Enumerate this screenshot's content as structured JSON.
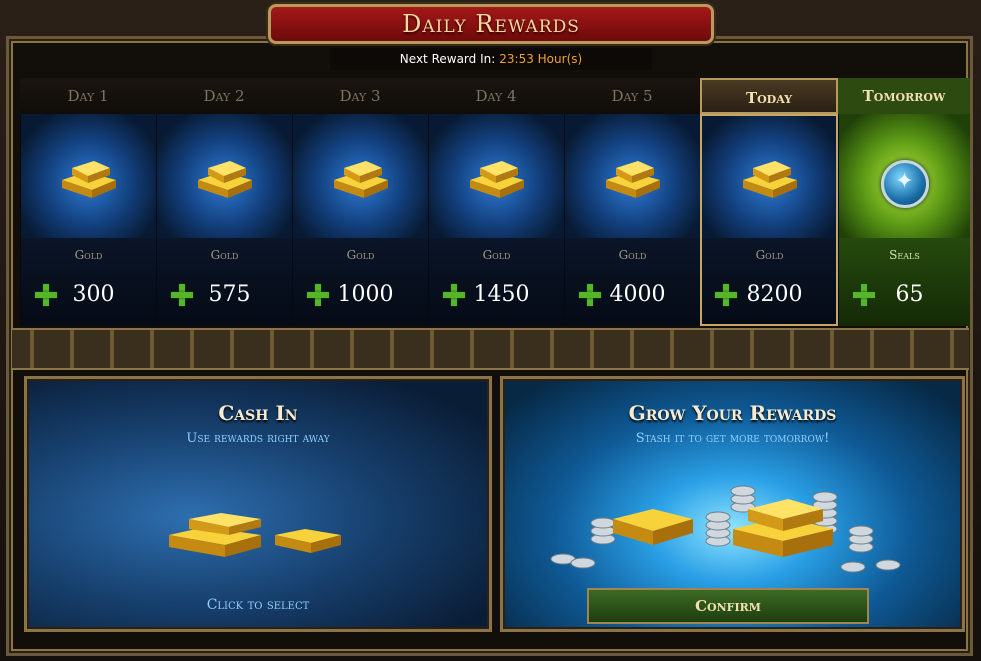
{
  "title": "Daily Rewards",
  "next_reward": {
    "label": "Next Reward In:",
    "time": "23:53 Hour(s)"
  },
  "days": [
    {
      "label": "Day 1",
      "type": "Gold",
      "amount": "300"
    },
    {
      "label": "Day 2",
      "type": "Gold",
      "amount": "575"
    },
    {
      "label": "Day 3",
      "type": "Gold",
      "amount": "1000"
    },
    {
      "label": "Day 4",
      "type": "Gold",
      "amount": "1450"
    },
    {
      "label": "Day 5",
      "type": "Gold",
      "amount": "4000"
    },
    {
      "label": "Today",
      "type": "Gold",
      "amount": "8200"
    },
    {
      "label": "Tomorrow",
      "type": "Seals",
      "amount": "65"
    }
  ],
  "cash_in": {
    "title": "Cash In",
    "subtitle": "Use rewards right away",
    "action": "Click to select"
  },
  "grow": {
    "title": "Grow Your Rewards",
    "subtitle": "Stash it to get more tomorrow!",
    "button": "Confirm"
  },
  "icons": {
    "gold": "gold-bars-icon",
    "seal": "dragon-seal-icon",
    "plus": "plus-icon",
    "coins": "silver-coins-icon"
  },
  "colors": {
    "banner": "#a41818",
    "frame": "#8c7448",
    "highlight": "#c7a765",
    "tomorrow": "#5c9a16",
    "timer": "#f2a32a"
  }
}
